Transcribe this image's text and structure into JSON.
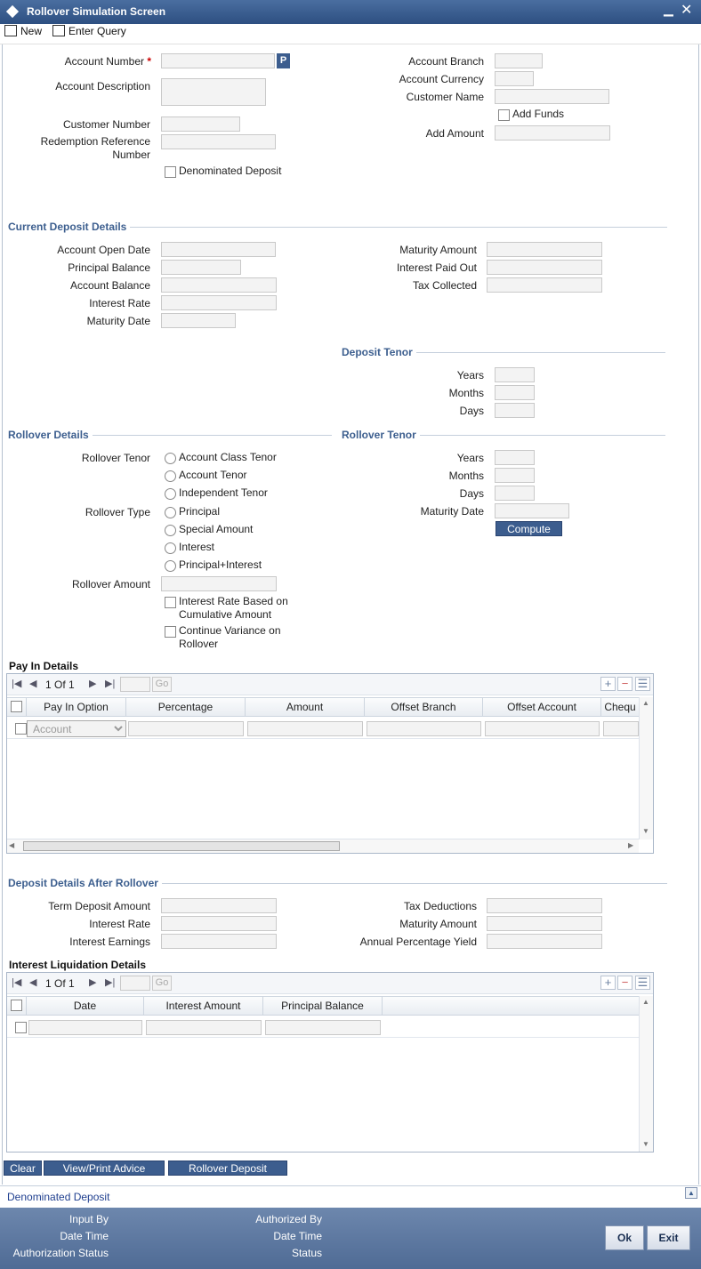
{
  "window": {
    "title": "Rollover Simulation Screen",
    "minimize": "▁",
    "close": "✕"
  },
  "toolbar": {
    "new_label": "New",
    "enter_query_label": "Enter Query"
  },
  "header": {
    "account_number": "Account Number",
    "required_mark": "*",
    "lov_button": "P",
    "account_description": "Account Description",
    "customer_number": "Customer Number",
    "redemption_ref": "Redemption Reference Number",
    "denominated_deposit": "Denominated Deposit",
    "account_branch": "Account Branch",
    "account_currency": "Account Currency",
    "customer_name": "Customer Name",
    "add_funds": "Add Funds",
    "add_amount": "Add Amount"
  },
  "current_deposit": {
    "title": "Current Deposit Details",
    "account_open_date": "Account Open Date",
    "principal_balance": "Principal Balance",
    "account_balance": "Account Balance",
    "interest_rate": "Interest Rate",
    "maturity_date": "Maturity Date",
    "maturity_amount": "Maturity Amount",
    "interest_paid_out": "Interest Paid Out",
    "tax_collected": "Tax Collected"
  },
  "deposit_tenor": {
    "title": "Deposit Tenor",
    "years": "Years",
    "months": "Months",
    "days": "Days"
  },
  "rollover_details": {
    "title": "Rollover Details",
    "rollover_tenor": "Rollover Tenor",
    "tenor_options": [
      "Account Class Tenor",
      "Account Tenor",
      "Independent Tenor"
    ],
    "rollover_type": "Rollover Type",
    "type_options": [
      "Principal",
      "Special Amount",
      "Interest",
      "Principal+Interest"
    ],
    "rollover_amount": "Rollover Amount",
    "interest_rate_cumulative": "Interest Rate Based on Cumulative Amount",
    "continue_variance": "Continue Variance on Rollover"
  },
  "rollover_tenor": {
    "title": "Rollover Tenor",
    "years": "Years",
    "months": "Months",
    "days": "Days",
    "maturity_date": "Maturity Date",
    "compute": "Compute"
  },
  "pay_in": {
    "title": "Pay In Details",
    "page": "1 Of 1",
    "go": "Go",
    "columns": [
      "Pay In Option",
      "Percentage",
      "Amount",
      "Offset Branch",
      "Offset Account",
      "Chequ"
    ],
    "row_option": "Account"
  },
  "after_rollover": {
    "title": "Deposit Details After Rollover",
    "term_deposit_amount": "Term Deposit Amount",
    "interest_rate": "Interest Rate",
    "interest_earnings": "Interest Earnings",
    "tax_deductions": "Tax Deductions",
    "maturity_amount": "Maturity Amount",
    "apy": "Annual Percentage Yield"
  },
  "interest_liq": {
    "title": "Interest Liquidation Details",
    "page": "1 Of 1",
    "go": "Go",
    "columns": [
      "Date",
      "Interest Amount",
      "Principal Balance"
    ]
  },
  "actions": {
    "clear": "Clear",
    "view_print": "View/Print Advice",
    "rollover_deposit": "Rollover Deposit"
  },
  "denominated_link": "Denominated Deposit",
  "footer": {
    "input_by": "Input By",
    "date_time": "Date Time",
    "auth_status": "Authorization Status",
    "authorized_by": "Authorized By",
    "date_time2": "Date Time",
    "status": "Status",
    "ok": "Ok",
    "exit": "Exit"
  },
  "colors": {
    "titlebar": "#2d4f81",
    "section": "#3d5f8f",
    "button": "#3c5d8e"
  }
}
